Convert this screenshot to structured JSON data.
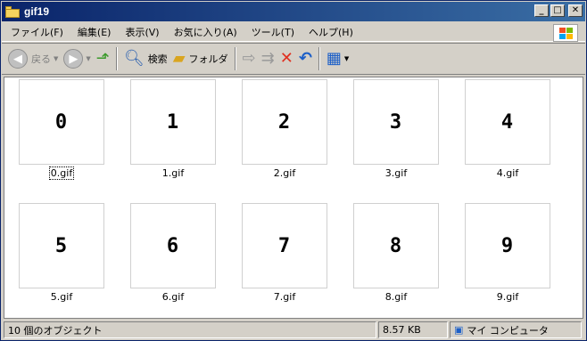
{
  "window": {
    "title": "gif19"
  },
  "menu": [
    "ファイル(F)",
    "編集(E)",
    "表示(V)",
    "お気に入り(A)",
    "ツール(T)",
    "ヘルプ(H)"
  ],
  "toolbar": {
    "back_label": "戻る",
    "search_label": "検索",
    "folders_label": "フォルダ"
  },
  "files": [
    {
      "digit": "0",
      "name": "0.gif"
    },
    {
      "digit": "1",
      "name": "1.gif"
    },
    {
      "digit": "2",
      "name": "2.gif"
    },
    {
      "digit": "3",
      "name": "3.gif"
    },
    {
      "digit": "4",
      "name": "4.gif"
    },
    {
      "digit": "5",
      "name": "5.gif"
    },
    {
      "digit": "6",
      "name": "6.gif"
    },
    {
      "digit": "7",
      "name": "7.gif"
    },
    {
      "digit": "8",
      "name": "8.gif"
    },
    {
      "digit": "9",
      "name": "9.gif"
    }
  ],
  "status": {
    "count": "10 個のオブジェクト",
    "size": "8.57 KB",
    "location": "マイ コンピュータ"
  },
  "colors": {
    "titlebar": "#0a246a",
    "face": "#d4d0c8",
    "delete": "#e03020",
    "undo": "#1c5fc8"
  }
}
